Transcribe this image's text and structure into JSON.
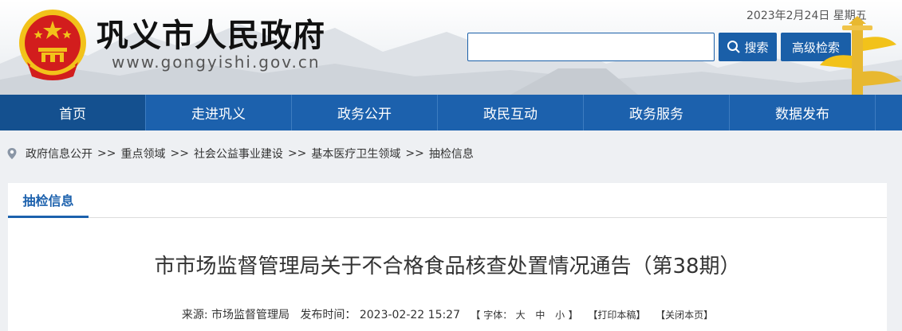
{
  "header": {
    "title": "巩义市人民政府",
    "url": "www.gongyishi.gov.cn",
    "date": "2023年2月24日 星期五",
    "search": {
      "placeholder": "",
      "button_label": "搜索",
      "advanced_label": "高级检索"
    }
  },
  "nav": {
    "items": [
      {
        "label": "首页",
        "active": true
      },
      {
        "label": "走进巩义"
      },
      {
        "label": "政务公开"
      },
      {
        "label": "政民互动"
      },
      {
        "label": "政务服务"
      },
      {
        "label": "数据发布"
      }
    ]
  },
  "breadcrumb": {
    "items": [
      "政府信息公开",
      "重点领域",
      "社会公益事业建设",
      "基本医疗卫生领域",
      "抽检信息"
    ],
    "separator": ">>"
  },
  "section": {
    "tab_label": "抽检信息"
  },
  "article": {
    "title": "市市场监督管理局关于不合格食品核查处置情况通告（第38期）",
    "source_label": "来源:",
    "source": "市场监督管理局",
    "publish_label": "发布时间：",
    "publish_time": "2023-02-22 15:27",
    "font_label": "【 字体：",
    "font_large": "大",
    "font_medium": "中",
    "font_small": "小",
    "font_close": "】",
    "print_label": "【打印本稿】",
    "close_label": "【关闭本页】"
  },
  "colors": {
    "primary": "#1c61ad",
    "nav_active": "#14508f",
    "emblem_red": "#d21d1d",
    "emblem_gold": "#f2c21a"
  },
  "icons": {
    "search": "search-icon",
    "location": "location-pin-icon",
    "emblem": "national-emblem-icon"
  }
}
